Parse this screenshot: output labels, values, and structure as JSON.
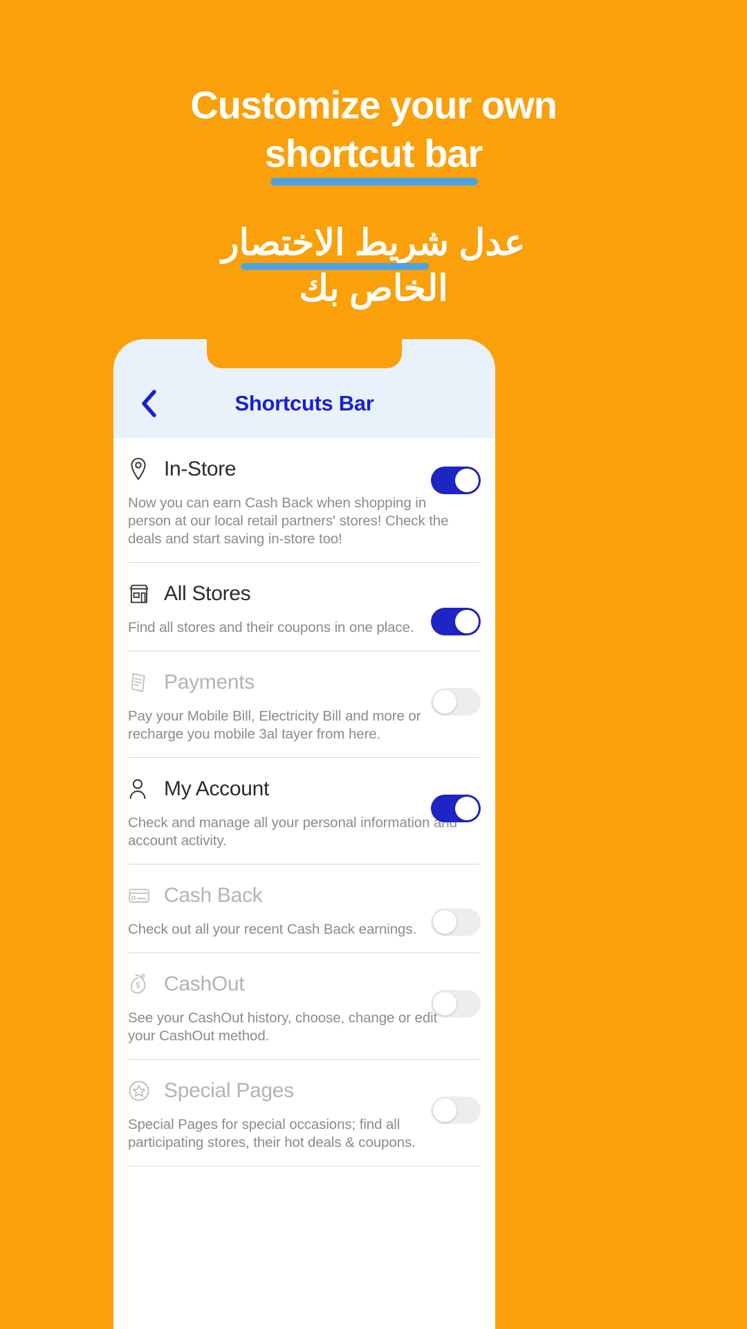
{
  "promo": {
    "line1": "Customize your own",
    "line2": "shortcut bar",
    "arabic_line1": "عدل شريط الاختصار",
    "arabic_line2": "الخاص بك",
    "accent_color": "#4BA3E3",
    "background_color": "#FAA00A"
  },
  "phone": {
    "nav": {
      "back_icon": "chevron-left-icon",
      "title": "Shortcuts Bar",
      "title_color": "#1A20D0",
      "header_background": "#E9F2FB"
    },
    "toggle_colors": {
      "on": "#1F24C4",
      "off": "#EDEDED"
    },
    "items": [
      {
        "icon": "location-pin-icon",
        "title": "In-Store",
        "description": "Now you can earn Cash Back when shopping in person at our local retail partners' stores! Check the deals and start saving in-store too!",
        "enabled": true,
        "toggle_state": "on"
      },
      {
        "icon": "storefront-icon",
        "title": "All Stores",
        "description": "Find all stores and their coupons in one place.",
        "enabled": true,
        "toggle_state": "on"
      },
      {
        "icon": "receipt-icon",
        "title": "Payments",
        "description": "Pay your Mobile Bill, Electricity Bill and more or recharge you mobile 3al tayer from here.",
        "enabled": false,
        "toggle_state": "off"
      },
      {
        "icon": "user-account-icon",
        "title": "My Account",
        "description": "Check and manage all your personal information and account activity.",
        "enabled": true,
        "toggle_state": "on"
      },
      {
        "icon": "credit-card-icon",
        "title": "Cash Back",
        "description": "Check out all your recent Cash Back earnings.",
        "enabled": false,
        "toggle_state": "off"
      },
      {
        "icon": "money-bag-icon",
        "title": "CashOut",
        "description": "See your CashOut history, choose, change or edit your CashOut method.",
        "enabled": false,
        "toggle_state": "off"
      },
      {
        "icon": "star-circle-icon",
        "title": "Special Pages",
        "description": "Special Pages for special occasions; find all participating stores, their hot deals & coupons.",
        "enabled": false,
        "toggle_state": "off"
      }
    ]
  }
}
